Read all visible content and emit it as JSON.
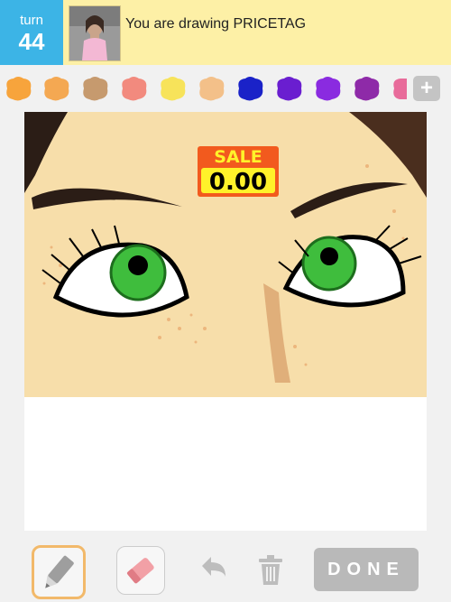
{
  "header": {
    "turn_label": "turn",
    "turn_number": "44",
    "prompt_text": "You are drawing PRICETAG"
  },
  "palette": {
    "colors": [
      "#f7a43c",
      "#f4a852",
      "#c69a6e",
      "#f28a7e",
      "#f7e35a",
      "#f3c089",
      "#1a22c8",
      "#6a1ed0",
      "#8a2be0",
      "#8e2aa8",
      "#e86b9a"
    ],
    "add_label": "+"
  },
  "drawing": {
    "tag_line1": "SALE",
    "tag_line2": "0.00"
  },
  "toolbar": {
    "done_label": "DONE"
  }
}
